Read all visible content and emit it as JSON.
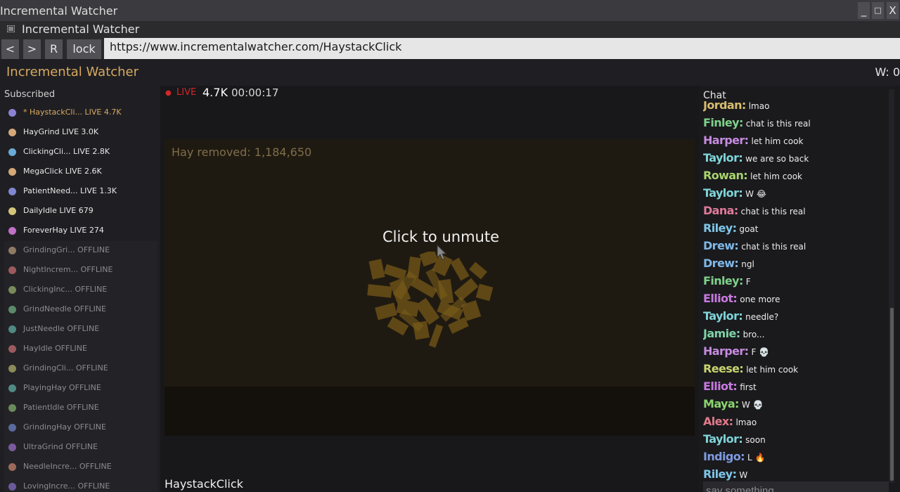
{
  "window": {
    "title": "Incremental Watcher",
    "minimize_label": "_",
    "maximize_label": "□",
    "close_label": "X"
  },
  "menubar": {
    "menu_icon": "menu-icon",
    "title": "Incremental Watcher"
  },
  "nav": {
    "back_label": "<",
    "forward_label": ">",
    "reload_label": "R",
    "lock_label": "lock",
    "url": "https://www.incrementalwatcher.com/HaystackClick"
  },
  "header": {
    "brand": "Incremental Watcher",
    "wins": "W: 0"
  },
  "sidebar": {
    "title": "Subscribed",
    "items": [
      {
        "label": "* HaystackCli...  LIVE 4.7K",
        "color": "#8c82d4",
        "status": "current"
      },
      {
        "label": "HayGrind  LIVE 3.0K",
        "color": "#d4a878",
        "status": "live"
      },
      {
        "label": "ClickingCli...  LIVE 2.8K",
        "color": "#6aaad6",
        "status": "live"
      },
      {
        "label": "MegaClick  LIVE 2.6K",
        "color": "#d4a878",
        "status": "live"
      },
      {
        "label": "PatientNeed...  LIVE 1.3K",
        "color": "#7f86d2",
        "status": "live"
      },
      {
        "label": "DailyIdle  LIVE 679",
        "color": "#d4c47a",
        "status": "live"
      },
      {
        "label": "ForeverHay  LIVE 274",
        "color": "#c070c6",
        "status": "live"
      },
      {
        "label": "GrindingGri...  OFFLINE",
        "color": "#8f7a63",
        "status": "offline"
      },
      {
        "label": "NightIncrem...  OFFLINE",
        "color": "#9c5a5d",
        "status": "offline"
      },
      {
        "label": "ClickingInc...  OFFLINE",
        "color": "#7a8a5a",
        "status": "offline"
      },
      {
        "label": "GrindNeedle  OFFLINE",
        "color": "#5a8a6a",
        "status": "offline"
      },
      {
        "label": "JustNeedle  OFFLINE",
        "color": "#4f8a83",
        "status": "offline"
      },
      {
        "label": "HayIdle  OFFLINE",
        "color": "#9c5a5d",
        "status": "offline"
      },
      {
        "label": "GrindingCli...  OFFLINE",
        "color": "#8a8a5a",
        "status": "offline"
      },
      {
        "label": "PlayingHay  OFFLINE",
        "color": "#4f8a83",
        "status": "offline"
      },
      {
        "label": "PatientIdle  OFFLINE",
        "color": "#6a8a5a",
        "status": "offline"
      },
      {
        "label": "GrindingHay  OFFLINE",
        "color": "#5a6a9c",
        "status": "offline"
      },
      {
        "label": "UltraGrind  OFFLINE",
        "color": "#7a5a9c",
        "status": "offline"
      },
      {
        "label": "NeedleIncre...  OFFLINE",
        "color": "#9c6a5a",
        "status": "offline"
      },
      {
        "label": "LovingIncre...  OFFLINE",
        "color": "#6a5a9c",
        "status": "offline"
      }
    ]
  },
  "stream": {
    "live_dot": "●",
    "live_label": "LIVE",
    "viewers": "4.7K",
    "uptime": "00:00:17",
    "hay_removed": "Hay removed: 1,184,650",
    "unmute": "Click to unmute",
    "title": "HaystackClick"
  },
  "chat": {
    "title": "Chat",
    "input_placeholder": "say something",
    "messages": [
      {
        "user": "Jordan:",
        "text": "lmao",
        "color": "#d8bc6e"
      },
      {
        "user": "Finley:",
        "text": "chat is this real",
        "color": "#7fd18a"
      },
      {
        "user": "Harper:",
        "text": "let him cook",
        "color": "#c68be0"
      },
      {
        "user": "Taylor:",
        "text": "we are so back",
        "color": "#7fd4d8"
      },
      {
        "user": "Rowan:",
        "text": "let him cook",
        "color": "#a9d46e"
      },
      {
        "user": "Taylor:",
        "text": "W 😂",
        "color": "#7fd4d8"
      },
      {
        "user": "Dana:",
        "text": "chat is this real",
        "color": "#e07a9a"
      },
      {
        "user": "Riley:",
        "text": "goat",
        "color": "#7fc6e8"
      },
      {
        "user": "Drew:",
        "text": "chat is this real",
        "color": "#7fb8e8"
      },
      {
        "user": "Drew:",
        "text": "ngl",
        "color": "#7fb8e8"
      },
      {
        "user": "Finley:",
        "text": "F",
        "color": "#7fd18a"
      },
      {
        "user": "Elliot:",
        "text": "one more",
        "color": "#c87ae0"
      },
      {
        "user": "Taylor:",
        "text": "needle?",
        "color": "#7fd4d8"
      },
      {
        "user": "Jamie:",
        "text": "bro...",
        "color": "#7fd4a8"
      },
      {
        "user": "Harper:",
        "text": "F 💀",
        "color": "#c68be0"
      },
      {
        "user": "Reese:",
        "text": "let him cook",
        "color": "#c8d46e"
      },
      {
        "user": "Elliot:",
        "text": "first",
        "color": "#c87ae0"
      },
      {
        "user": "Maya:",
        "text": "W 💀",
        "color": "#8ad46e"
      },
      {
        "user": "Alex:",
        "text": "lmao",
        "color": "#e07a8a"
      },
      {
        "user": "Taylor:",
        "text": "soon",
        "color": "#7fd4d8"
      },
      {
        "user": "Indigo:",
        "text": "L 🔥",
        "color": "#7f9ae0"
      },
      {
        "user": "Riley:",
        "text": "W",
        "color": "#7fc6e8"
      }
    ]
  }
}
